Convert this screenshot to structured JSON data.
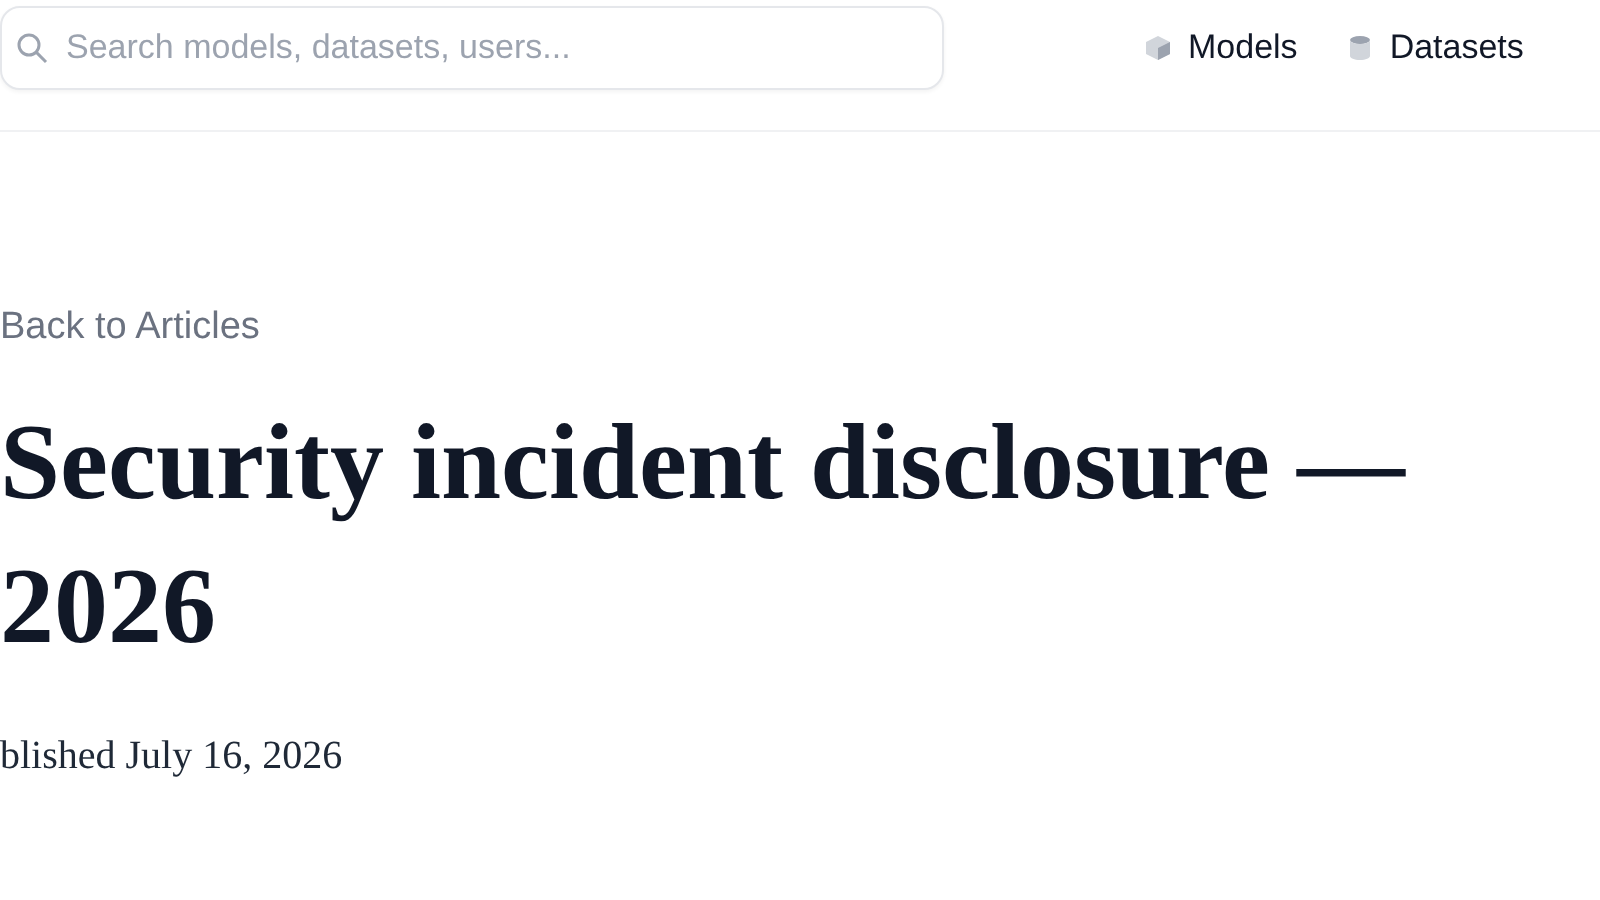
{
  "header": {
    "search": {
      "placeholder": "Search models, datasets, users..."
    },
    "nav": [
      {
        "kind": "models",
        "label": "Models"
      },
      {
        "kind": "datasets",
        "label": "Datasets"
      }
    ]
  },
  "article": {
    "back_link": "Back to Articles",
    "title_lines": [
      "Security incident disclosure —",
      "2026"
    ],
    "published": "blished July 16, 2026"
  }
}
